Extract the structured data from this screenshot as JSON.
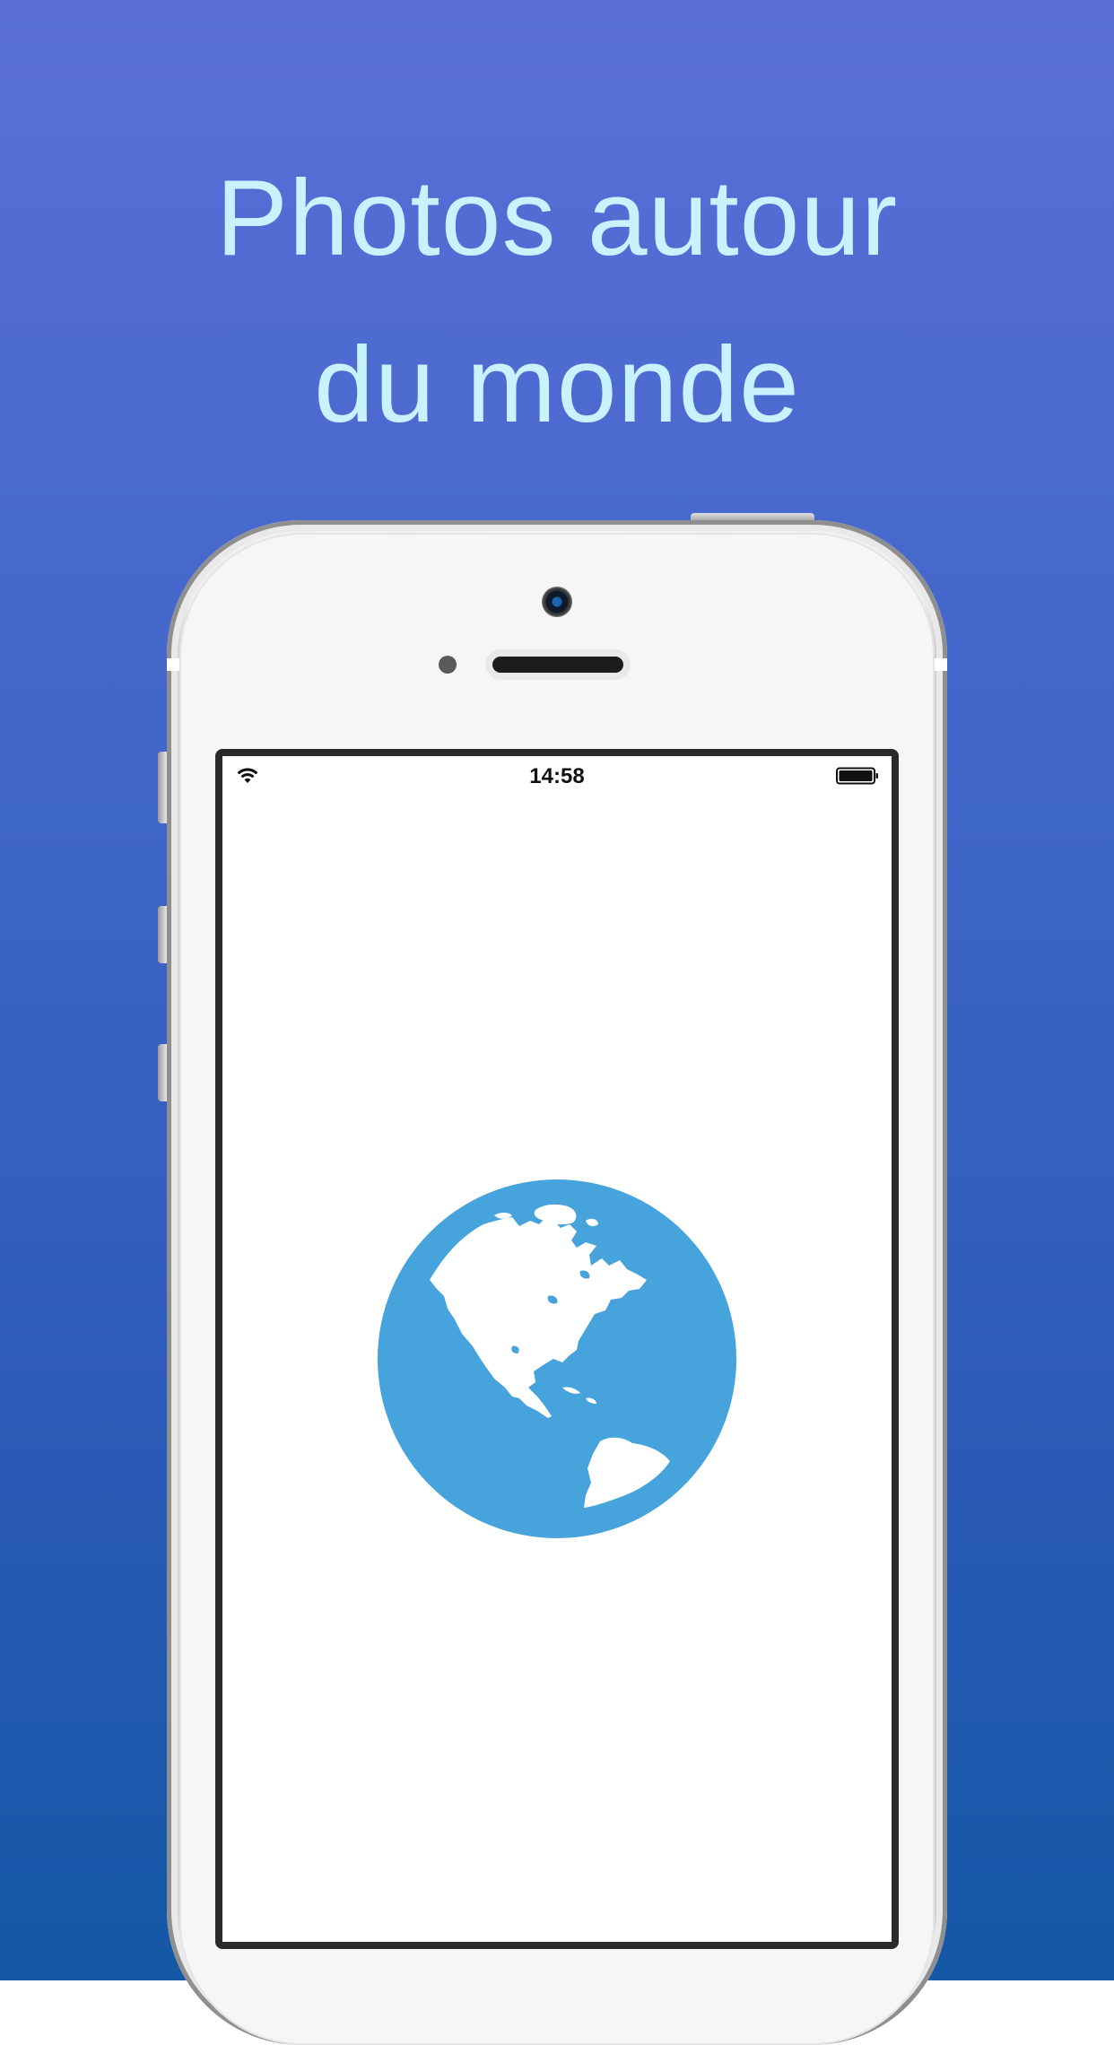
{
  "headline": {
    "line1": "Photos autour",
    "line2": "du monde"
  },
  "status_bar": {
    "time": "14:58",
    "wifi_icon": "wifi-icon",
    "battery_icon": "battery-icon"
  },
  "splash": {
    "icon": "globe-icon",
    "icon_color": "#47a3dc"
  },
  "colors": {
    "background_top": "#5a6fd8",
    "background_bottom": "#1458a6",
    "headline_text": "#c9f2ff"
  }
}
